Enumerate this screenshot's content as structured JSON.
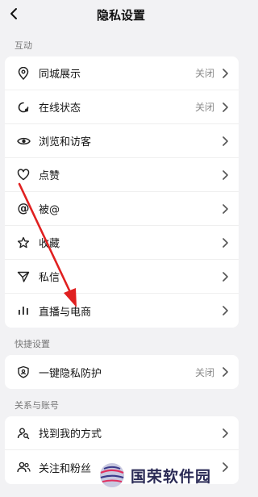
{
  "header": {
    "title": "隐私设置"
  },
  "sections": [
    {
      "label": "互动",
      "items": [
        {
          "label": "同城展示",
          "value": "关闭",
          "icon": "location-pin-icon"
        },
        {
          "label": "在线状态",
          "value": "关闭",
          "icon": "online-status-icon"
        },
        {
          "label": "浏览和访客",
          "value": "",
          "icon": "eye-icon"
        },
        {
          "label": "点赞",
          "value": "",
          "icon": "heart-icon"
        },
        {
          "label": "被@",
          "value": "",
          "icon": "at-icon"
        },
        {
          "label": "收藏",
          "value": "",
          "icon": "star-icon"
        },
        {
          "label": "私信",
          "value": "",
          "icon": "send-icon"
        },
        {
          "label": "直播与电商",
          "value": "",
          "icon": "bars-icon"
        }
      ]
    },
    {
      "label": "快捷设置",
      "items": [
        {
          "label": "一键隐私防护",
          "value": "关闭",
          "icon": "shield-icon"
        }
      ]
    },
    {
      "label": "关系与账号",
      "items": [
        {
          "label": "找到我的方式",
          "value": "",
          "icon": "user-search-icon"
        },
        {
          "label": "关注和粉丝",
          "value": "",
          "icon": "users-icon"
        }
      ]
    }
  ],
  "watermark": {
    "text": "国荣软件园"
  },
  "colors": {
    "annotation_arrow": "#e02020",
    "background": "#f2f2f4"
  }
}
